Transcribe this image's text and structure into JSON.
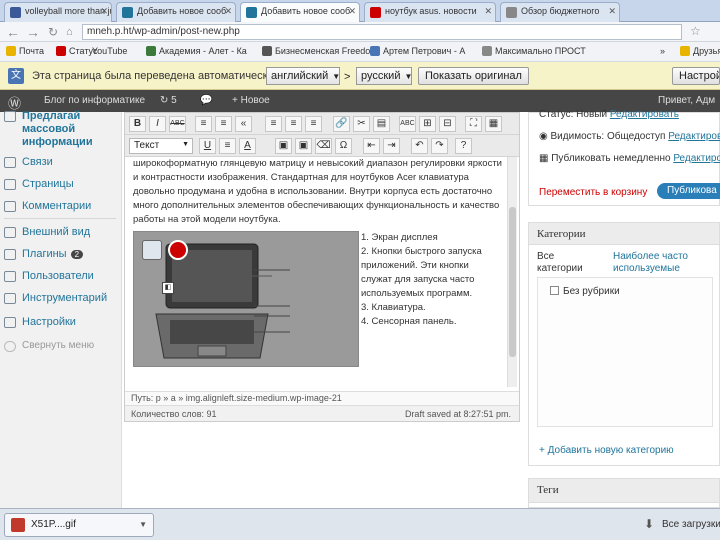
{
  "browser": {
    "tabs": [
      {
        "label": "volleyball more than ju",
        "color": "#3b5998"
      },
      {
        "label": "Добавить новое сооб",
        "color": "#21759b"
      },
      {
        "label": "Добавить новое сооб",
        "color": "#21759b"
      },
      {
        "label": "ноутбук asus. новости",
        "color": "#cc0000"
      },
      {
        "label": "Обзор бюджетного",
        "color": "#888888"
      }
    ],
    "url": "mneh.p.ht/wp-admin/post-new.php",
    "bookmarks": [
      {
        "label": "Почта",
        "color": "#e8b400"
      },
      {
        "label": "Статус",
        "color": "#cc0000"
      },
      {
        "label": "YouTube",
        "color": "#cc0000"
      },
      {
        "label": "Академия - Алет - Ка",
        "color": "#3b7a3b"
      },
      {
        "label": "Бизнесменская Freedo",
        "color": "#555555"
      },
      {
        "label": "Артем Петрович - А",
        "color": "#4a75b5"
      },
      {
        "label": "Максимально ПРОСТ",
        "color": "#888888"
      },
      {
        "label": "»",
        "color": ""
      },
      {
        "label": "Друзья",
        "color": "#e8b400"
      }
    ]
  },
  "translate": {
    "message": "Эта страница была переведена автоматически",
    "from_lang": "английский",
    "arrow": ">",
    "to_lang": "русский",
    "show_original": "Показать оригинал",
    "settings": "Настрой"
  },
  "adminbar": {
    "site": "Блог по информатике",
    "updates": "5",
    "new": "Новое",
    "greeting": "Привет, Адм"
  },
  "sidebar": {
    "top_items": [
      "Предлагай",
      "массовой",
      "информации"
    ],
    "items": [
      {
        "label": "Связи"
      },
      {
        "label": "Страницы"
      },
      {
        "label": "Комментарии"
      },
      {
        "label": "Внешний вид"
      },
      {
        "label": "Плагины",
        "badge": "2"
      },
      {
        "label": "Пользователи"
      },
      {
        "label": "Инструментарий"
      },
      {
        "label": "Настройки"
      }
    ],
    "collapse": "Свернуть меню"
  },
  "editor": {
    "row1": [
      "B",
      "I",
      "ABC",
      "≡",
      "≡",
      "«",
      "≡",
      "≡",
      "≡",
      "🔗",
      "✂",
      "▤",
      "ABC",
      "⊞",
      "⊟",
      "⛶",
      "▦"
    ],
    "format_select": "Текст",
    "row2": [
      "U",
      "≡",
      "A",
      "▣",
      "▣",
      "⌫",
      "Ω",
      "⇤",
      "⇥",
      "↶",
      "↷",
      "?"
    ],
    "paragraph1": "широкоформатную глянцевую матрицу и невысокий диапазон регулировки яркости и контрастности изображения. Стандартная для ноутбуков Acer клавиатура довольно продумана и удобна в использовании. Внутри корпуса есть достаточно много дополнительных элементов обеспечивающих функциональность и качество работы на этой модели ноутбука.",
    "list": [
      "1. Экран дисплея",
      "2. Кнопки быстрого запуска приложений. Эти кнопки служат для запуска часто используемых программ.",
      "3. Клавиатура.",
      "4. Сенсорная панель."
    ],
    "path": "Путь: p » a » img.alignleft.size-medium.wp-image-21",
    "word_count": "Количество слов: 91",
    "draft": "Draft saved at 8:27:51 pm."
  },
  "publish": {
    "status_label": "Статус: Новый",
    "status_link": "Редактировать",
    "visibility_label": "Видимость: Общедоступ",
    "visibility_link": "Редактироват",
    "publish_label": "Публиковать немедленно",
    "publish_link": "Редактиров",
    "trash": "Переместить в корзину",
    "publish_button": "Публикова"
  },
  "categories": {
    "title": "Категории",
    "tab_all": "Все категории",
    "tab_popular": "Наиболее часто используемые",
    "items": [
      "Без рубрики"
    ],
    "add": "+ Добавить новую категорию"
  },
  "tags": {
    "title": "Теги"
  },
  "downloads": {
    "file": "X51P....gif",
    "show_all": "Все загрузки"
  },
  "colors": {
    "link": "#21759b",
    "adminbar": "#464646",
    "publish": "#2a7fb8"
  }
}
